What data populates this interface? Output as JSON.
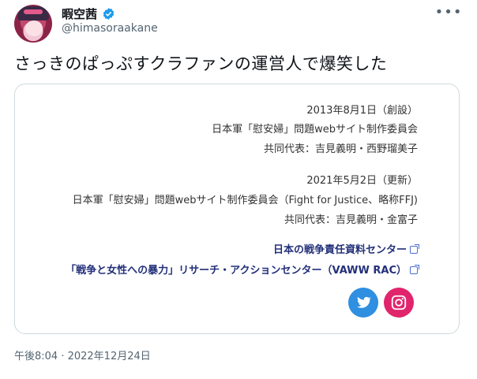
{
  "author": {
    "display_name": "暇空茜",
    "handle": "@himasoraakane"
  },
  "menu": {
    "more_label": "•••"
  },
  "tweet": {
    "text": "さっきのぱっぷすクラファンの運営人で爆笑した",
    "timestamp": "午後8:04 · 2022年12月24日"
  },
  "card": {
    "block1": {
      "date": "2013年8月1日（創設）",
      "org": "日本軍「慰安婦」問題webサイト制作委員会",
      "reps": "共同代表：吉見義明・西野瑠美子"
    },
    "block2": {
      "date": "2021年5月2日（更新）",
      "org": "日本軍「慰安婦」問題webサイト制作委員会（Fight for Justice、略称FFJ)",
      "reps": "共同代表：吉見義明・金富子"
    },
    "links": [
      "日本の戦争責任資料センター",
      "「戦争と女性への暴力」リサーチ・アクションセンター（VAWW RAC）"
    ],
    "social": [
      "twitter",
      "instagram"
    ]
  },
  "colors": {
    "accent_link": "#23307a",
    "verified": "#1d9bf0",
    "twitter_button": "#2f8fe0",
    "instagram_button": "#e0256c"
  }
}
